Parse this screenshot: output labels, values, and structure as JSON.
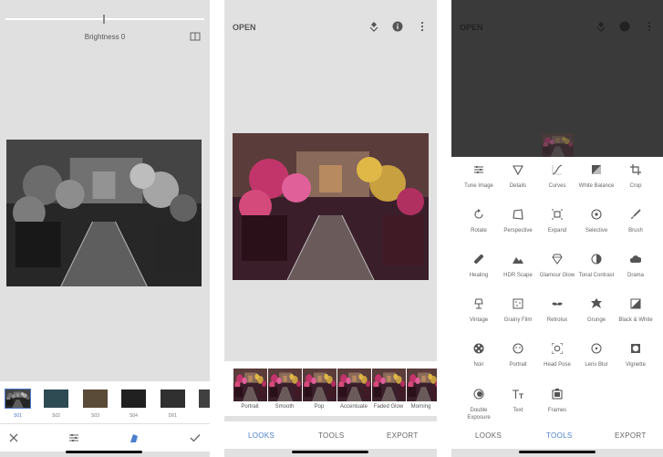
{
  "panel1": {
    "brightness_label": "Brightness 0",
    "brightness_value": 0,
    "filters": [
      {
        "label": "S01",
        "active": true
      },
      {
        "label": "S02",
        "active": false
      },
      {
        "label": "S03",
        "active": false
      },
      {
        "label": "S04",
        "active": false
      },
      {
        "label": "D01",
        "active": false
      },
      {
        "label": "",
        "active": false
      }
    ],
    "toolbar_icons": [
      "close-icon",
      "sliders-icon",
      "styles-icon",
      "check-icon"
    ]
  },
  "panel2": {
    "open_label": "OPEN",
    "top_icons": [
      "healing-icon",
      "info-icon",
      "more-icon"
    ],
    "looks": [
      "Portrait",
      "Smooth",
      "Pop",
      "Accentuate",
      "Faded Glow",
      "Morning"
    ],
    "nav": [
      "LOOKS",
      "TOOLS",
      "EXPORT"
    ]
  },
  "panel3": {
    "open_label": "OPEN",
    "tools": [
      "Tune Image",
      "Details",
      "Curves",
      "White Balance",
      "Crop",
      "Rotate",
      "Perspective",
      "Expand",
      "Selective",
      "Brush",
      "Healing",
      "HDR Scape",
      "Glamour Glow",
      "Tonal Contrast",
      "Drama",
      "Vintage",
      "Grainy Film",
      "Retrolux",
      "Grunge",
      "Black & White",
      "Noir",
      "Portrait",
      "Head Pose",
      "Lens Blur",
      "Vignette",
      "Double Exposure",
      "Text",
      "Frames"
    ],
    "nav": [
      "LOOKS",
      "TOOLS",
      "EXPORT"
    ],
    "nav_active": "TOOLS"
  },
  "colors": {
    "accent": "#4a7fce",
    "dim_overlay": "#3a3a3a"
  }
}
